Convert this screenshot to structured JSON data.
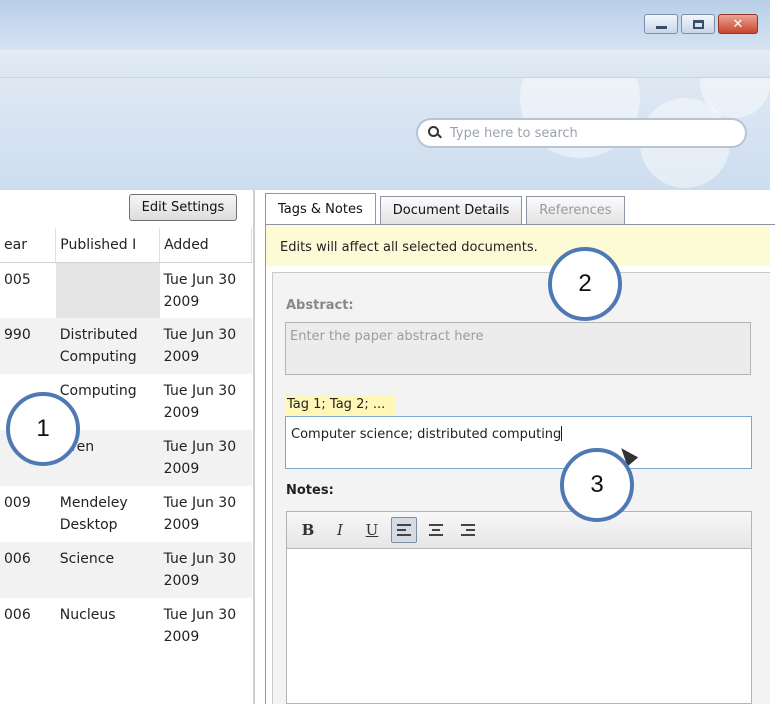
{
  "window": {
    "minimize_label": "Minimize",
    "maximize_label": "Maximize",
    "close_label": "Close"
  },
  "search": {
    "placeholder": "Type here to search"
  },
  "left": {
    "edit_settings_label": "Edit Settings",
    "columns": [
      "ear",
      "Published I",
      "Added"
    ],
    "rows": [
      {
        "year": "005",
        "published": [
          "",
          ""
        ],
        "added": [
          "Tue Jun 30",
          "2009"
        ]
      },
      {
        "year": "990",
        "published": [
          "Distributed",
          "Computing"
        ],
        "added": [
          "Tue Jun 30",
          "2009"
        ]
      },
      {
        "year": "",
        "published": [
          "Computing",
          ""
        ],
        "added": [
          "Tue Jun 30",
          "2009"
        ]
      },
      {
        "year": "",
        "published": [
          "even",
          ""
        ],
        "added": [
          "Tue Jun 30",
          "2009"
        ]
      },
      {
        "year": "009",
        "published": [
          "Mendeley",
          "Desktop"
        ],
        "added": [
          "Tue Jun 30",
          "2009"
        ]
      },
      {
        "year": "006",
        "published": [
          "Science",
          ""
        ],
        "added": [
          "Tue Jun 30",
          "2009"
        ]
      },
      {
        "year": "006",
        "published": [
          "Nucleus",
          ""
        ],
        "added": [
          "Tue Jun 30",
          "2009"
        ]
      }
    ]
  },
  "tabs": [
    {
      "label": "Tags & Notes"
    },
    {
      "label": "Document Details"
    },
    {
      "label": "References"
    }
  ],
  "details": {
    "notice": "Edits will affect all selected documents.",
    "abstract_label": "Abstract:",
    "abstract_placeholder": "Enter the paper abstract here",
    "tag_hint": "Tag 1; Tag 2; ...",
    "tags_value": "Computer science; distributed computing",
    "notes_label": "Notes:",
    "toolbar": {
      "bold": "B",
      "italic": "I",
      "underline": "U"
    }
  },
  "callouts": [
    "1",
    "2",
    "3"
  ],
  "colors": {
    "callout_border": "#4f79b5",
    "notice_bg": "#fdfbd6",
    "tag_hint_bg": "#fff7b8"
  }
}
